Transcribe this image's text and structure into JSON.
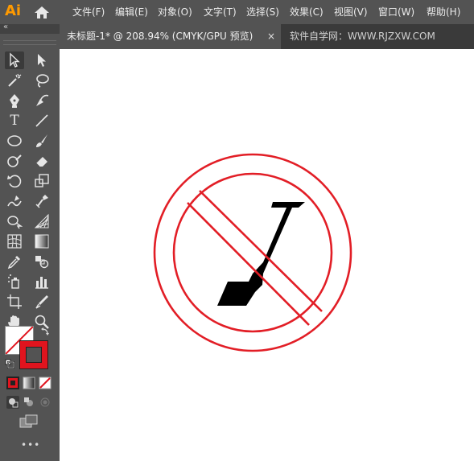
{
  "app": {
    "logo_text": "Ai",
    "icons": {
      "logo": "illustrator-logo",
      "home": "home-icon"
    }
  },
  "menu": {
    "items": [
      {
        "label": "文件(F)"
      },
      {
        "label": "编辑(E)"
      },
      {
        "label": "对象(O)"
      },
      {
        "label": "文字(T)"
      },
      {
        "label": "选择(S)"
      },
      {
        "label": "效果(C)"
      },
      {
        "label": "视图(V)"
      },
      {
        "label": "窗口(W)"
      },
      {
        "label": "帮助(H)"
      }
    ]
  },
  "panel": {
    "collapse_glyph": "«"
  },
  "tabs": {
    "active": {
      "title": "未标题-1* @ 208.94% (CMYK/GPU 预览)",
      "close": "×"
    },
    "inactive": {
      "title": "软件自学网：WWW.RJZXW.COM"
    }
  },
  "tools": {
    "type_glyph": "T",
    "more_glyph": "•••",
    "names": [
      "selection-tool",
      "direct-selection-tool",
      "magic-wand-tool",
      "lasso-tool",
      "pen-tool",
      "curvature-tool",
      "type-tool",
      "line-segment-tool",
      "ellipse-tool",
      "paintbrush-tool",
      "shaper-tool",
      "eraser-tool",
      "rotate-tool",
      "scale-tool",
      "warp-tool",
      "free-transform-tool",
      "shape-builder-tool",
      "perspective-grid-tool",
      "mesh-tool",
      "gradient-tool",
      "eyedropper-tool",
      "blend-tool",
      "symbol-sprayer-tool",
      "column-graph-tool",
      "artboard-tool",
      "slice-tool",
      "hand-tool",
      "zoom-tool"
    ]
  },
  "colors": {
    "ui_bg": "#535353",
    "tab_bar": "#3a3a3a",
    "canvas": "#ffffff",
    "stroke_red": "#e0141e",
    "art_red": "#e21e26",
    "art_black": "#000000"
  }
}
